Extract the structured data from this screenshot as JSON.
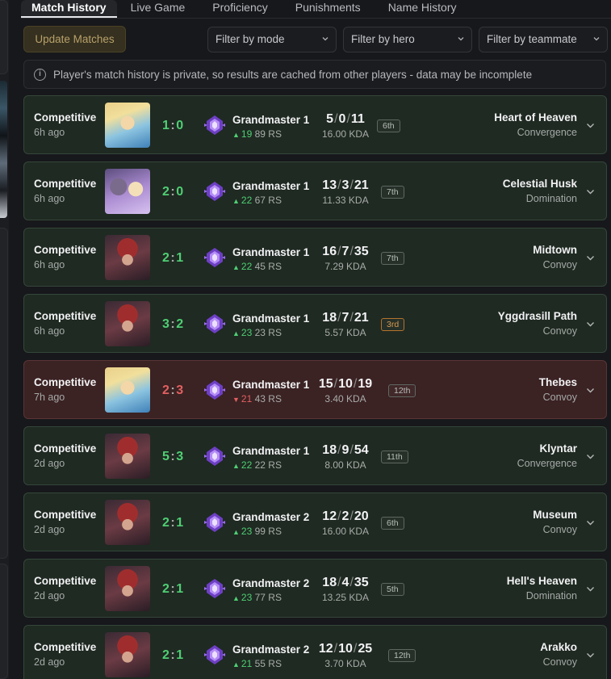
{
  "tabs": [
    "Match History",
    "Live Game",
    "Proficiency",
    "Punishments",
    "Name History"
  ],
  "active_tab": 0,
  "update_button": "Update Matches",
  "filters": [
    "Filter by mode",
    "Filter by hero",
    "Filter by teammate"
  ],
  "notice": "Player's match history is private, so results are cached from other players - data may be incomplete",
  "colors": {
    "win_card": "#1f2a22",
    "loss_card": "#3b2223",
    "win_text": "#4fcf74",
    "loss_text": "#e26060",
    "rank_purple": "#9b6cf0"
  },
  "matches": [
    {
      "mode": "Competitive",
      "ago": "6h ago",
      "hero_icon": "blonde-hero",
      "score_a": "1",
      "score_b": "0",
      "win": true,
      "rank": "Grandmaster 1",
      "rs_change": "19",
      "rs_dir": "up",
      "rs": "89 RS",
      "k": "5",
      "d": "0",
      "a": "11",
      "kda": "16.00 KDA",
      "place": "6th",
      "mvp": false,
      "map": "Heart of Heaven",
      "game_mode": "Convergence"
    },
    {
      "mode": "Competitive",
      "ago": "6h ago",
      "hero_icon": "duo-hero",
      "score_a": "2",
      "score_b": "0",
      "win": true,
      "rank": "Grandmaster 1",
      "rs_change": "22",
      "rs_dir": "up",
      "rs": "67 RS",
      "k": "13",
      "d": "3",
      "a": "21",
      "kda": "11.33 KDA",
      "place": "7th",
      "mvp": false,
      "map": "Celestial Husk",
      "game_mode": "Domination"
    },
    {
      "mode": "Competitive",
      "ago": "6h ago",
      "hero_icon": "red-hero",
      "score_a": "2",
      "score_b": "1",
      "win": true,
      "rank": "Grandmaster 1",
      "rs_change": "22",
      "rs_dir": "up",
      "rs": "45 RS",
      "k": "16",
      "d": "7",
      "a": "35",
      "kda": "7.29 KDA",
      "place": "7th",
      "mvp": false,
      "map": "Midtown",
      "game_mode": "Convoy"
    },
    {
      "mode": "Competitive",
      "ago": "6h ago",
      "hero_icon": "red-hero",
      "score_a": "3",
      "score_b": "2",
      "win": true,
      "rank": "Grandmaster 1",
      "rs_change": "23",
      "rs_dir": "up",
      "rs": "23 RS",
      "k": "18",
      "d": "7",
      "a": "21",
      "kda": "5.57 KDA",
      "place": "3rd",
      "mvp": true,
      "map": "Yggdrasill Path",
      "game_mode": "Convoy"
    },
    {
      "mode": "Competitive",
      "ago": "7h ago",
      "hero_icon": "blonde-hero",
      "score_a": "2",
      "score_b": "3",
      "win": false,
      "rank": "Grandmaster 1",
      "rs_change": "21",
      "rs_dir": "down",
      "rs": "43 RS",
      "k": "15",
      "d": "10",
      "a": "19",
      "kda": "3.40 KDA",
      "place": "12th",
      "mvp": false,
      "map": "Thebes",
      "game_mode": "Convoy"
    },
    {
      "mode": "Competitive",
      "ago": "2d ago",
      "hero_icon": "red-hero",
      "score_a": "5",
      "score_b": "3",
      "win": true,
      "rank": "Grandmaster 1",
      "rs_change": "22",
      "rs_dir": "up",
      "rs": "22 RS",
      "k": "18",
      "d": "9",
      "a": "54",
      "kda": "8.00 KDA",
      "place": "11th",
      "mvp": false,
      "map": "Klyntar",
      "game_mode": "Convergence"
    },
    {
      "mode": "Competitive",
      "ago": "2d ago",
      "hero_icon": "red-hero",
      "score_a": "2",
      "score_b": "1",
      "win": true,
      "rank": "Grandmaster 2",
      "rs_change": "23",
      "rs_dir": "up",
      "rs": "99 RS",
      "k": "12",
      "d": "2",
      "a": "20",
      "kda": "16.00 KDA",
      "place": "6th",
      "mvp": false,
      "map": "Museum",
      "game_mode": "Convoy"
    },
    {
      "mode": "Competitive",
      "ago": "2d ago",
      "hero_icon": "red-hero",
      "score_a": "2",
      "score_b": "1",
      "win": true,
      "rank": "Grandmaster 2",
      "rs_change": "23",
      "rs_dir": "up",
      "rs": "77 RS",
      "k": "18",
      "d": "4",
      "a": "35",
      "kda": "13.25 KDA",
      "place": "5th",
      "mvp": false,
      "map": "Hell's Heaven",
      "game_mode": "Domination"
    },
    {
      "mode": "Competitive",
      "ago": "2d ago",
      "hero_icon": "red-hero",
      "score_a": "2",
      "score_b": "1",
      "win": true,
      "rank": "Grandmaster 2",
      "rs_change": "21",
      "rs_dir": "up",
      "rs": "55 RS",
      "k": "12",
      "d": "10",
      "a": "25",
      "kda": "3.70 KDA",
      "place": "12th",
      "mvp": false,
      "map": "Arakko",
      "game_mode": "Convoy"
    }
  ]
}
